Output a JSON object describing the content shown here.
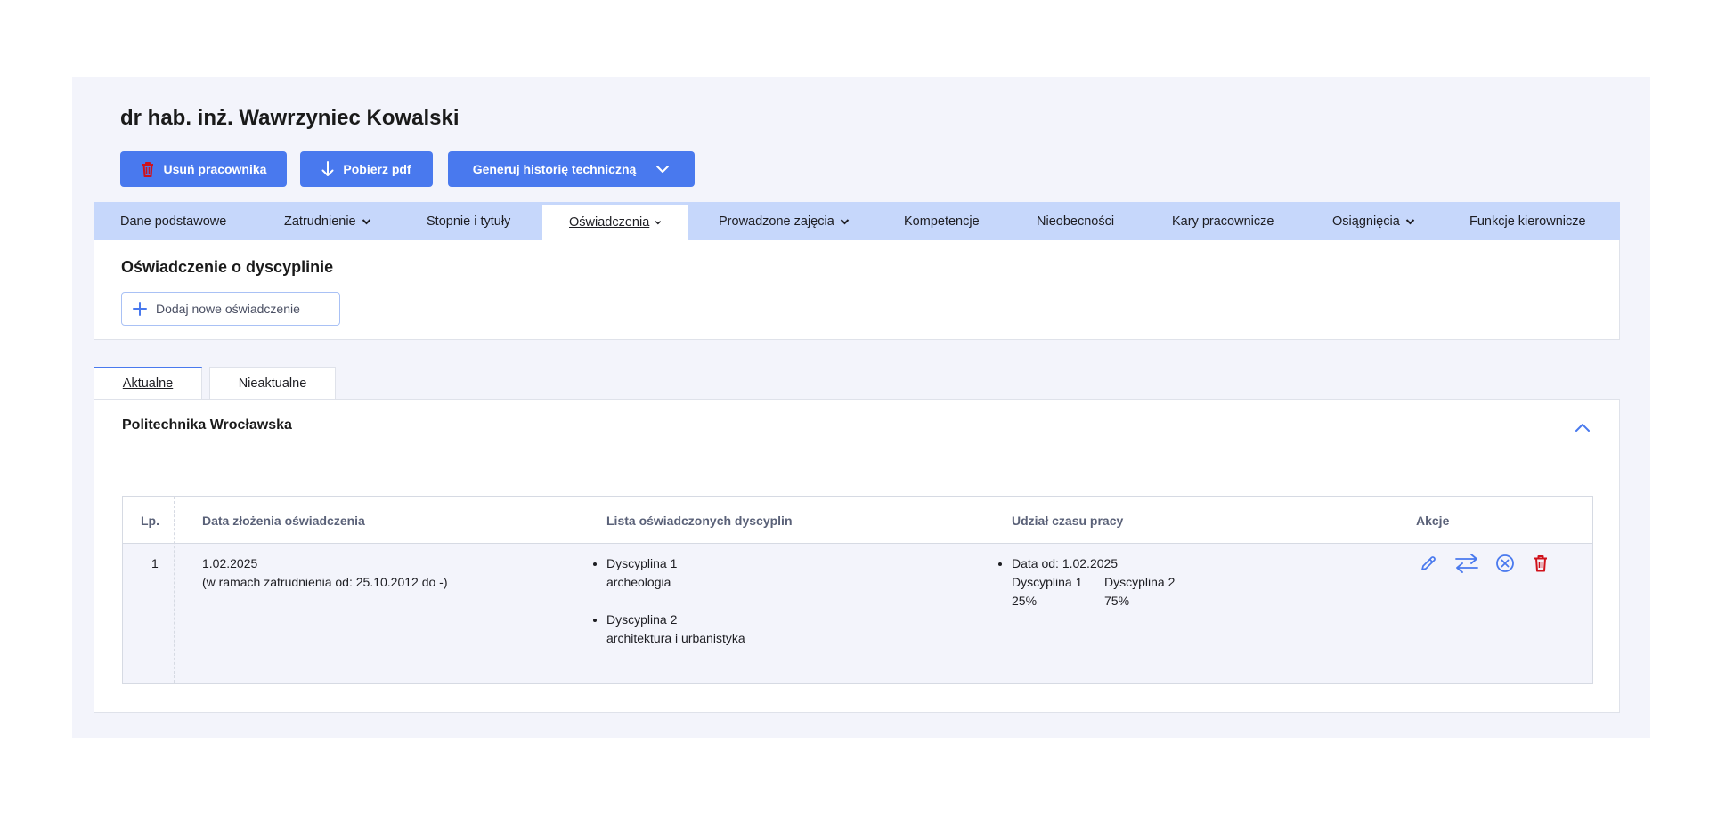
{
  "header": {
    "title": "dr hab. inż. Wawrzyniec Kowalski",
    "buttons": {
      "delete_label": "Usuń pracownika",
      "pdf_label": "Pobierz pdf",
      "history_label": "Generuj historię techniczną"
    }
  },
  "nav": {
    "items": [
      {
        "label": "Dane podstawowe",
        "has_dropdown": false
      },
      {
        "label": "Zatrudnienie",
        "has_dropdown": true
      },
      {
        "label": "Stopnie i tytuły",
        "has_dropdown": false
      },
      {
        "label": "Oświadczenia",
        "has_dropdown": true,
        "active": true
      },
      {
        "label": "Prowadzone zajęcia",
        "has_dropdown": true
      },
      {
        "label": "Kompetencje",
        "has_dropdown": false
      },
      {
        "label": "Nieobecności",
        "has_dropdown": false
      },
      {
        "label": "Kary pracownicze",
        "has_dropdown": false
      },
      {
        "label": "Osiągnięcia",
        "has_dropdown": true
      },
      {
        "label": "Funkcje kierownicze",
        "has_dropdown": false
      }
    ]
  },
  "declaration": {
    "title": "Oświadczenie o dyscyplinie",
    "add_label": "Dodaj nowe oświadczenie"
  },
  "tabs": [
    {
      "label": "Aktualne",
      "active": true
    },
    {
      "label": "Nieaktualne",
      "active": false
    }
  ],
  "section": {
    "title": "Politechnika Wrocławska"
  },
  "table": {
    "headers": {
      "lp": "Lp.",
      "date": "Data złożenia oświadczenia",
      "disciplines": "Lista oświadczonych dyscyplin",
      "share": "Udział czasu pracy",
      "actions": "Akcje"
    },
    "rows": [
      {
        "lp": "1",
        "date": "1.02.2025",
        "employment": "(w ramach zatrudnienia od: 25.10.2012 do -)",
        "disciplines": [
          {
            "name": "Dyscyplina 1",
            "value": "archeologia"
          },
          {
            "name": "Dyscyplina 2",
            "value": "architektura i urbanistyka"
          }
        ],
        "share": {
          "date_label": "Data od: 1.02.2025",
          "items": [
            {
              "name": "Dyscyplina 1",
              "percent": "25%"
            },
            {
              "name": "Dyscyplina 2",
              "percent": "75%"
            }
          ]
        }
      }
    ]
  },
  "colors": {
    "primary": "#4979ee",
    "nav_bg": "#c6d7fb",
    "panel_bg": "#f3f4fb",
    "danger": "#d0121b"
  },
  "icons": [
    "trash-icon",
    "arrow-down-icon",
    "chevron-down-icon",
    "plus-icon",
    "chevron-up-icon",
    "pencil-icon",
    "swap-icon",
    "cancel-circle-icon"
  ]
}
